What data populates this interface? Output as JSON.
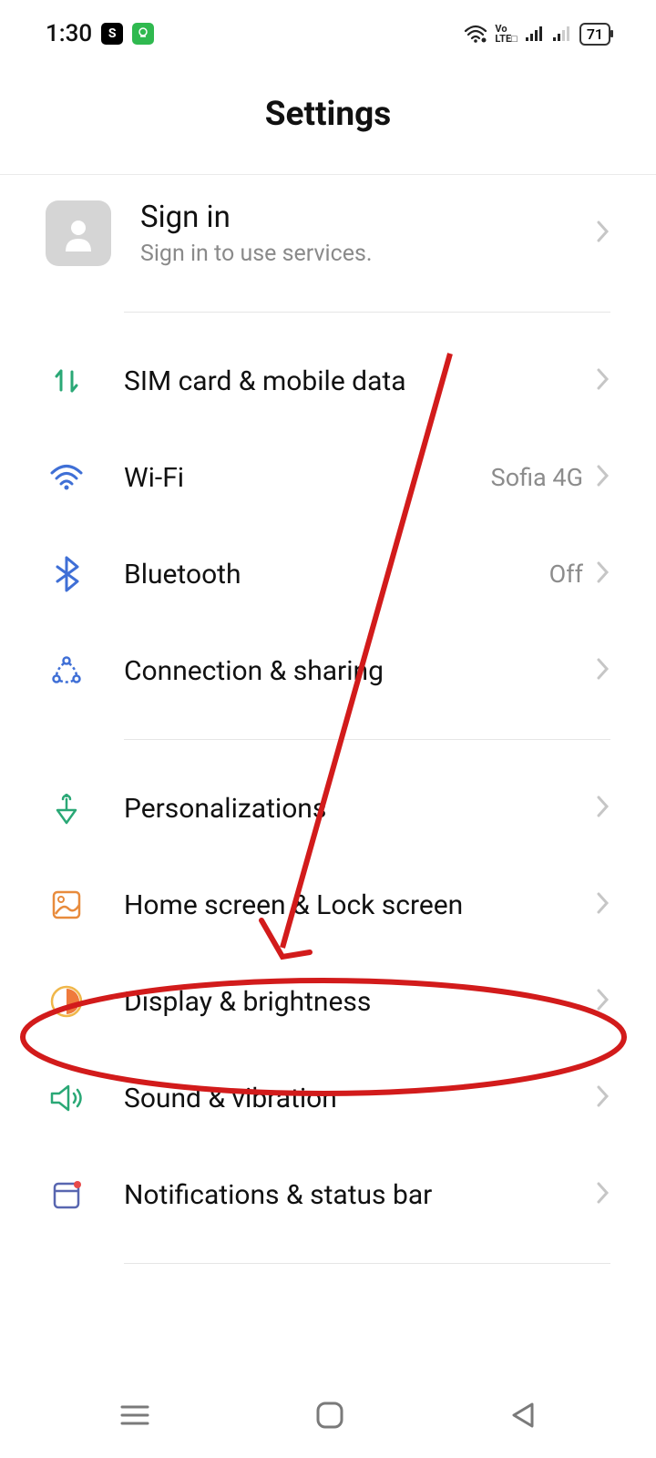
{
  "statusbar": {
    "time": "1:30",
    "battery": "71"
  },
  "header": {
    "title": "Settings"
  },
  "signin": {
    "title": "Sign in",
    "subtitle": "Sign in to use services."
  },
  "rows": {
    "sim": {
      "title": "SIM card & mobile data"
    },
    "wifi": {
      "title": "Wi-Fi",
      "value": "Sofia 4G"
    },
    "bluetooth": {
      "title": "Bluetooth",
      "value": "Off"
    },
    "connection": {
      "title": "Connection & sharing"
    },
    "personalizations": {
      "title": "Personalizations"
    },
    "home": {
      "title": "Home screen & Lock screen"
    },
    "display": {
      "title": "Display & brightness"
    },
    "sound": {
      "title": "Sound & vibration"
    },
    "notifications": {
      "title": "Notifications & status bar"
    }
  }
}
